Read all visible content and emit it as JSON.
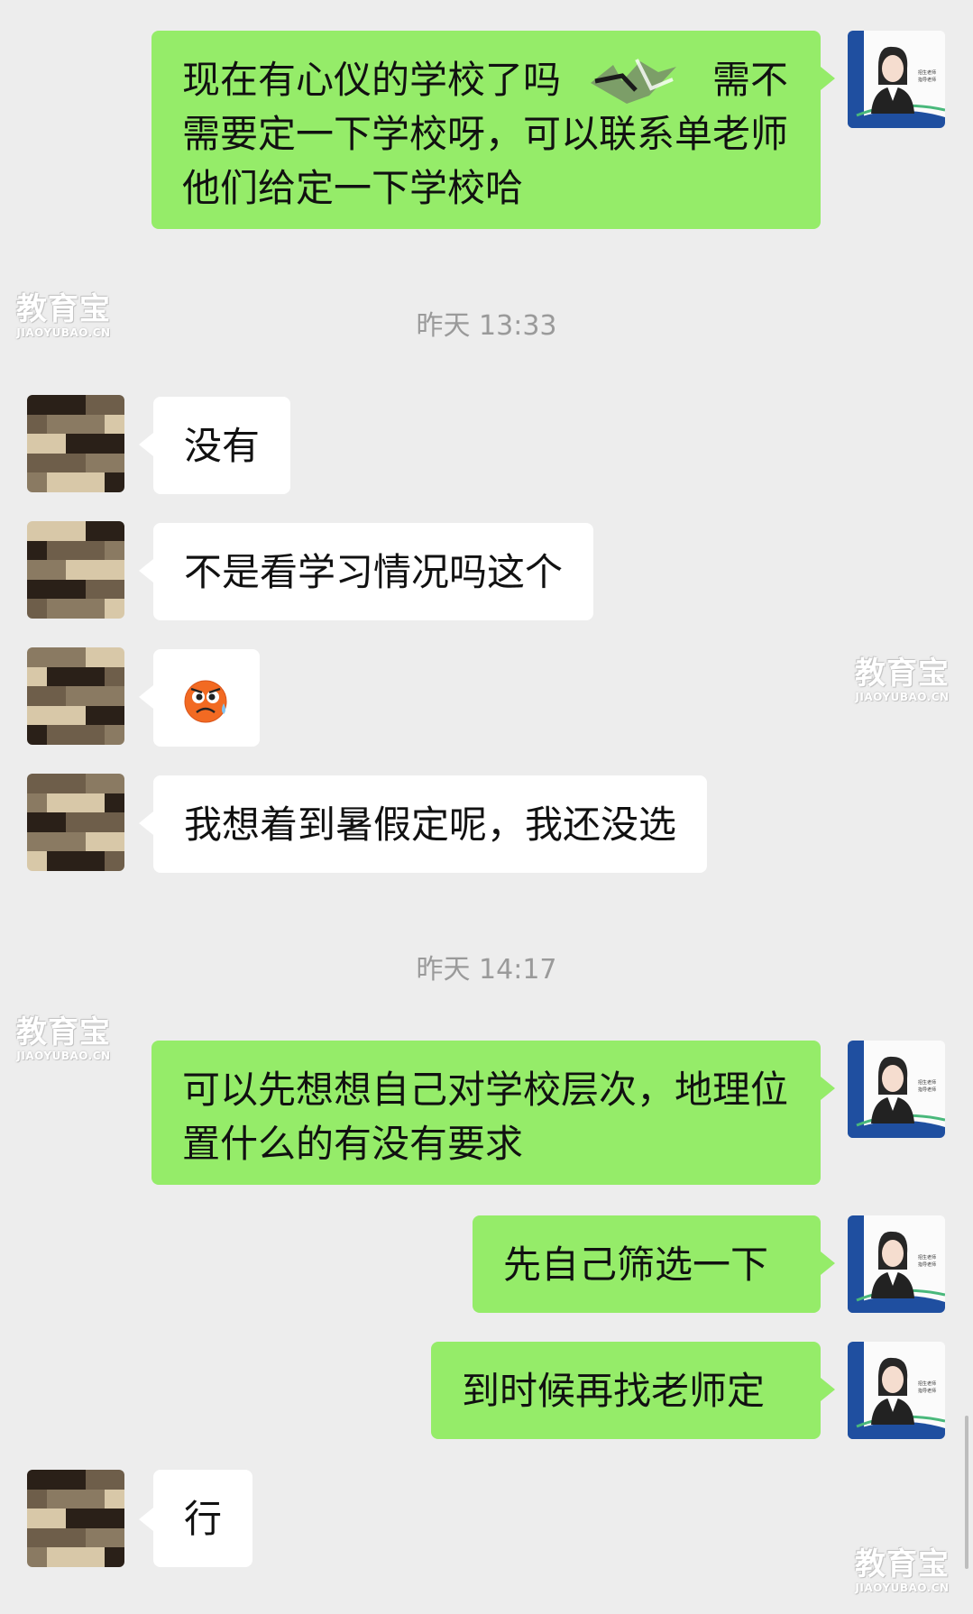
{
  "watermark": {
    "main": "教育宝",
    "sub": "JIAOYUBAO.CN"
  },
  "timestamps": [
    "昨天 13:33",
    "昨天 14:17"
  ],
  "messages": {
    "m1": "现在有心仪的学校了吗　　　　需不需要定一下学校呀，可以联系单老师他们给定一下学校哈",
    "m2": "没有",
    "m3": "不是看学习情况吗这个",
    "m4_emoji": "sweat-angry-face-emoji",
    "m5": "我想着到暑假定呢，我还没选",
    "m6": "可以先想想自己对学校层次，地理位置什么的有没有要求",
    "m7": "先自己筛选一下",
    "m8": "到时候再找老师定",
    "m9": "行"
  },
  "colors": {
    "background": "#ededed",
    "me_bubble": "#95ec69",
    "them_bubble": "#ffffff",
    "teacher_blue": "#1f4fa0"
  },
  "icons": [
    "teacher-avatar",
    "user-avatar-pixelated",
    "sweat-angry-face-emoji"
  ]
}
